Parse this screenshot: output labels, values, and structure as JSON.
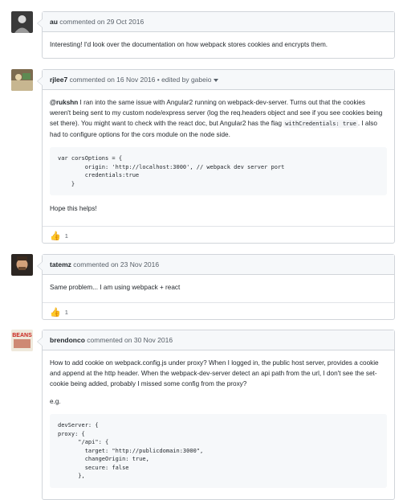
{
  "comments": [
    {
      "author": "au",
      "meta": " commented on 29 Oct 2016",
      "body": "Interesting! I'd look over the documentation on how webpack stores cookies and encrypts them."
    },
    {
      "author": "rjlee7",
      "meta": " commented on 16 Nov 2016 • edited by ",
      "editor": "gabeio",
      "mention": "@rukshn",
      "body_part1": " I ran into the same issue with Angular2 running on webpack-dev-server. Turns out that the cookies weren't being sent to my custom node/express server (log the req.headers object and see if you see cookies being set there). You might want to check with the react doc, but Angular2 has the flag ",
      "inline_code": "withCredentials: true",
      "body_part2": ". I also had to configure options for the cors module on the node side.",
      "code": "var corsOptions = {\n        origin: 'http://localhost:3000', // webpack dev server port\n        credentials:true\n    }",
      "closing": "Hope this helps!",
      "reaction_count": "1"
    },
    {
      "author": "tatemz",
      "meta": " commented on 23 Nov 2016",
      "body": "Same problem... I am using webpack + react",
      "reaction_count": "1"
    },
    {
      "author": "brendonco",
      "meta": " commented on 30 Nov 2016",
      "avatar_text": "BEANS",
      "body": "How to add cookie on webpack.config.js under proxy? When I logged in, the public host server, provides a cookie and append at the http header. When the webpack-dev-server detect an api path from the url, I don't see the set-cookie being added, probably I missed some config from the proxy?",
      "eg": "e.g.",
      "code": "devServer: {\nproxy: {\n      \"/api\": {\n        target: \"http://publicdomain:3000\",\n        changeOrigin: true,\n        secure: false\n      },"
    }
  ],
  "icons": {
    "thumbs_up": "👍"
  },
  "colors": {
    "link": "#0366d6",
    "header_bg": "#f6f8fa",
    "border": "#d1d5da",
    "thumb": "#f0b400"
  }
}
